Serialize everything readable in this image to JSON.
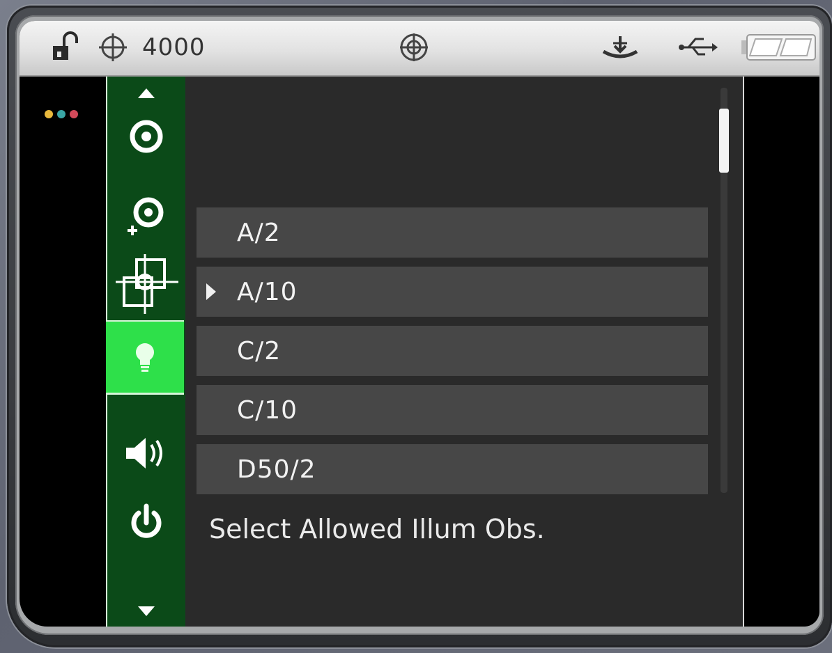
{
  "statusbar": {
    "lock_icon": "unlocked-padlock-icon",
    "target_icon": "crosshair-icon",
    "count": "4000",
    "center_icon": "measure-target-icon",
    "tray_icon": "sample-tray-icon",
    "usb_icon": "usb-icon",
    "battery_icon": "battery-icon"
  },
  "sidebar": {
    "items": [
      {
        "name": "scroll-up",
        "icon": "triangle-up-icon"
      },
      {
        "name": "measure",
        "icon": "target-ring-icon"
      },
      {
        "name": "add-measure",
        "icon": "target-ring-plus-icon"
      },
      {
        "name": "alignment",
        "icon": "square-crosshair-icon"
      },
      {
        "name": "illumination",
        "icon": "lightbulb-icon",
        "active": true
      },
      {
        "name": "volume",
        "icon": "speaker-icon"
      },
      {
        "name": "power",
        "icon": "power-icon"
      },
      {
        "name": "scroll-down",
        "icon": "triangle-down-icon"
      }
    ]
  },
  "list": {
    "items": [
      {
        "label": "A/2",
        "selected": false
      },
      {
        "label": "A/10",
        "selected": true
      },
      {
        "label": "C/2",
        "selected": false
      },
      {
        "label": "C/10",
        "selected": false
      },
      {
        "label": "D50/2",
        "selected": false
      }
    ]
  },
  "hint": "Select Allowed Illum Obs.",
  "colors": {
    "sidebar_bg": "#0b4a18",
    "sidebar_active": "#2ee04a",
    "panel_bg": "#2a2a2a",
    "row_bg": "#474747",
    "dot_yellow": "#e8b83c",
    "dot_teal": "#3aa6a6",
    "dot_red": "#d24a5a"
  }
}
